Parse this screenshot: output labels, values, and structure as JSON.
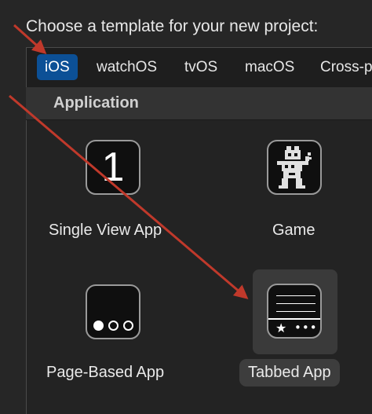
{
  "header": {
    "prompt": "Choose a template for your new project:"
  },
  "tabs": [
    {
      "label": "iOS",
      "selected": true
    },
    {
      "label": "watchOS",
      "selected": false
    },
    {
      "label": "tvOS",
      "selected": false
    },
    {
      "label": "macOS",
      "selected": false
    },
    {
      "label": "Cross-p",
      "selected": false
    }
  ],
  "section": {
    "title": "Application"
  },
  "templates": [
    {
      "name": "Single View App",
      "icon": "single-view-icon",
      "glyph": "1"
    },
    {
      "name": "Game",
      "icon": "game-robot-icon"
    },
    {
      "name": "Page-Based App",
      "icon": "page-based-icon"
    },
    {
      "name": "Tabbed App",
      "icon": "tabbed-icon",
      "selected": true,
      "tab_star": "★",
      "tab_dots": "•••"
    }
  ],
  "colors": {
    "accent": "#0c5096",
    "annotation_arrow": "#c0392b",
    "background": "#262626"
  }
}
